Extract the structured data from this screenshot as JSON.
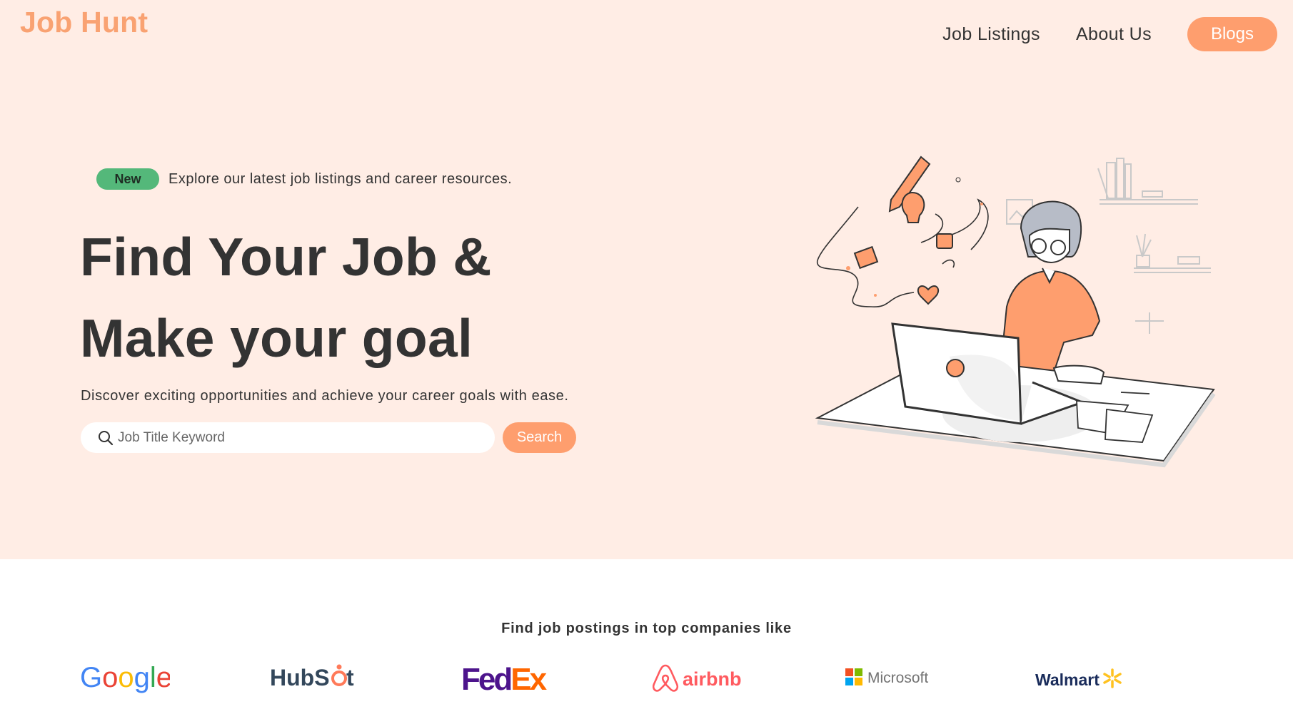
{
  "brand": {
    "name": "Job Hunt",
    "color": "#f9a272"
  },
  "nav": {
    "links": [
      "Job Listings",
      "About Us"
    ],
    "cta": "Blogs"
  },
  "announcement": {
    "badge": "New",
    "text": "Explore our latest job listings and career resources."
  },
  "hero": {
    "headline_line1": "Find Your Job &",
    "headline_line2": "Make your goal",
    "subtext": "Discover exciting opportunities and achieve your career goals with ease."
  },
  "search": {
    "placeholder": "Job Title Keyword",
    "value": "",
    "button": "Search"
  },
  "companies": {
    "title": "Find job postings in top companies like",
    "logos": [
      "Google",
      "HubSpot",
      "FedEx",
      "airbnb",
      "Microsoft",
      "Walmart"
    ]
  },
  "colors": {
    "hero_bg": "#ffede5",
    "accent": "#fe9e6e",
    "badge": "#54b87a",
    "text": "#333333"
  }
}
